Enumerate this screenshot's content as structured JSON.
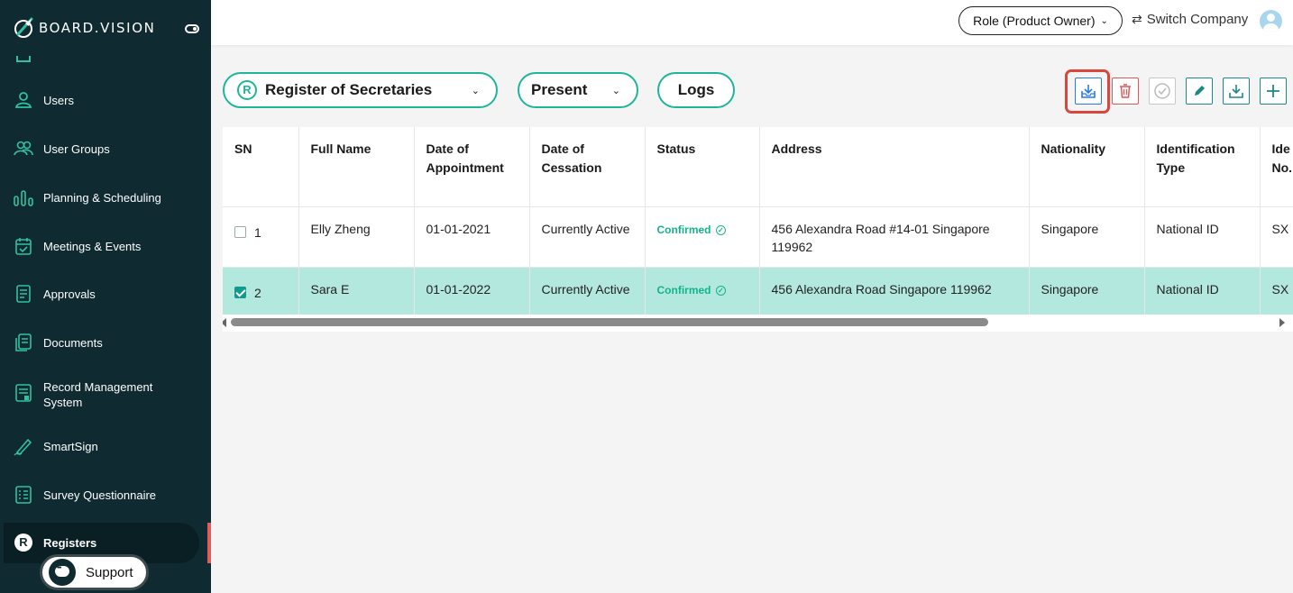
{
  "sidebar": {
    "brand": "BOARD.VISION",
    "items": [
      {
        "label": "Users",
        "icon": "user-icon"
      },
      {
        "label": "User Groups",
        "icon": "user-group-icon"
      },
      {
        "label": "Planning & Scheduling",
        "icon": "bar-chart-icon"
      },
      {
        "label": "Meetings & Events",
        "icon": "calendar-icon"
      },
      {
        "label": "Approvals",
        "icon": "document-icon"
      },
      {
        "label": "Documents",
        "icon": "documents-icon"
      },
      {
        "label": "Record Management System",
        "icon": "record-icon"
      },
      {
        "label": "SmartSign",
        "icon": "pen-icon"
      },
      {
        "label": "Survey Questionnaire",
        "icon": "survey-icon"
      },
      {
        "label": "Registers",
        "icon": "registers-icon",
        "active": true
      }
    ],
    "support_label": "Support",
    "register_glyph": "R"
  },
  "topbar": {
    "role_label": "Role (Product Owner)",
    "switch_label": "Switch Company"
  },
  "filters": {
    "register_glyph": "R",
    "register_label": "Register of Secretaries",
    "period_label": "Present",
    "logs_label": "Logs"
  },
  "toolbar": {
    "buttons": [
      "import-icon",
      "delete-icon",
      "approve-icon",
      "edit-icon",
      "download-icon",
      "add-icon"
    ],
    "highlighted": "import-icon"
  },
  "table": {
    "headers": [
      "SN",
      "Full Name",
      "Date of Appointment",
      "Date of Cessation",
      "Status",
      "Address",
      "Nationality",
      "Identification Type",
      "Identification No."
    ],
    "headers_display": [
      "SN",
      "Full Name",
      "Date of\nAppointment",
      "Date of\nCessation",
      "Status",
      "Address",
      "Nationality",
      "Identification\nType",
      "Ide\nNo."
    ],
    "rows": [
      {
        "sn": "1",
        "checked": false,
        "name": "Elly Zheng",
        "appointment": "01-01-2021",
        "cessation": "Currently Active",
        "status": "Confirmed",
        "address": "456 Alexandra Road #14-01 Singapore 119962",
        "nationality": "Singapore",
        "id_type": "National ID",
        "id_no": "SX"
      },
      {
        "sn": "2",
        "checked": true,
        "name": "Sara E",
        "appointment": "01-01-2022",
        "cessation": "Currently Active",
        "status": "Confirmed",
        "address": "456 Alexandra Road Singapore 119962",
        "nationality": "Singapore",
        "id_type": "National ID",
        "id_no": "SX"
      }
    ]
  },
  "colors": {
    "sidebar_bg": "#0f2a30",
    "accent": "#1fb59a",
    "selected_row": "#b3e8df",
    "highlight_border": "#d9463b",
    "delete_red": "#e25757"
  }
}
